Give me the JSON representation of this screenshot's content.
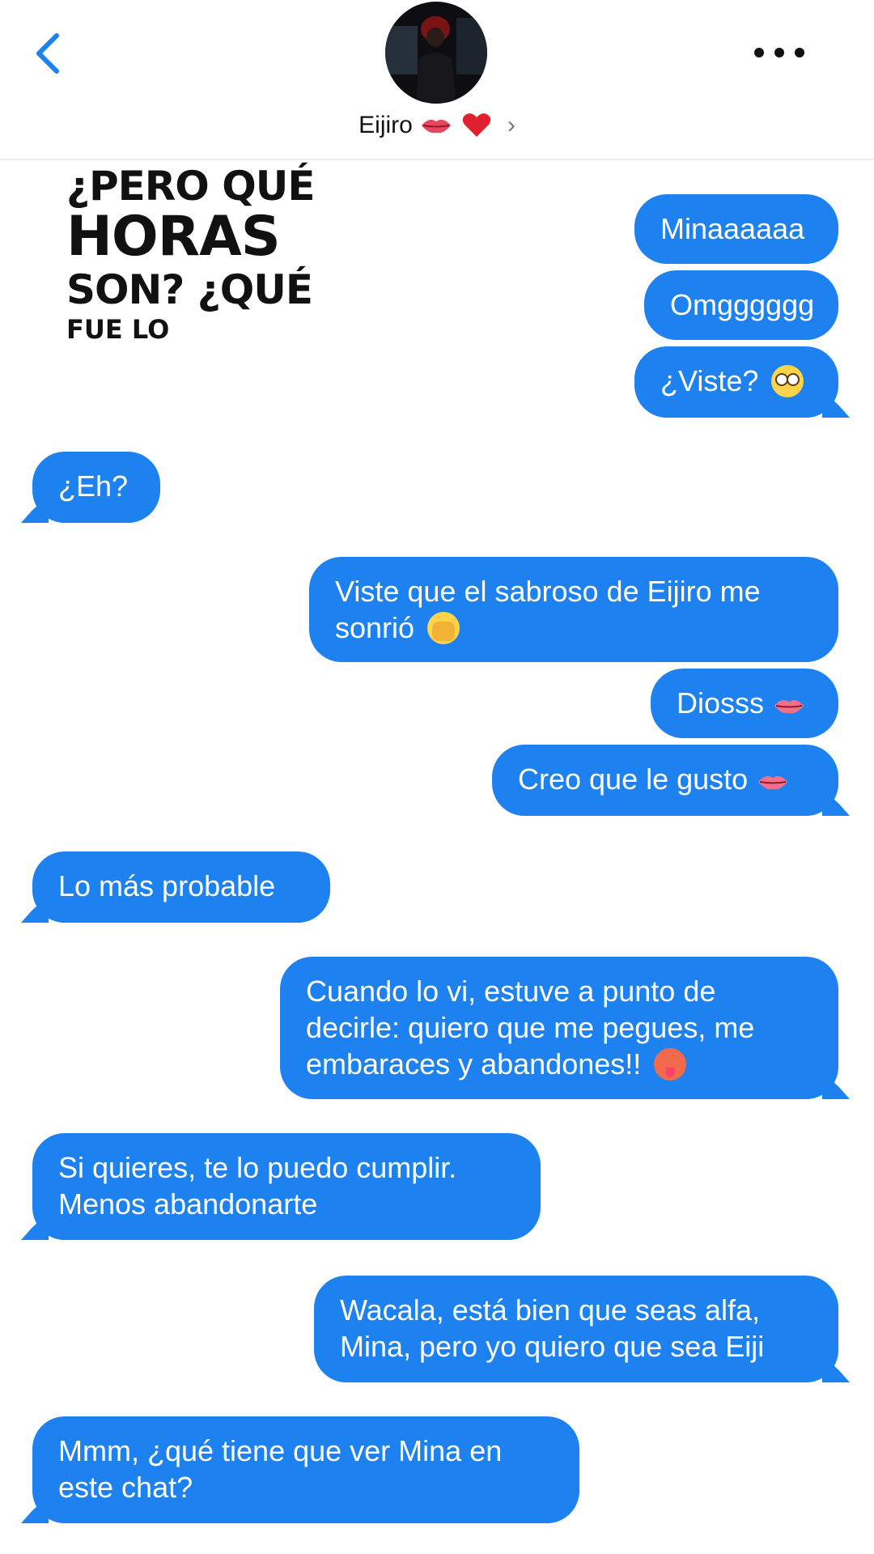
{
  "header": {
    "contact_name": "Eijiro",
    "back_icon": "chevron-left-icon",
    "more_icon": "more-horizontal-icon",
    "name_emojis": [
      "lips-emoji",
      "heart-emoji"
    ],
    "accent_color": "#1d82f0"
  },
  "meme": {
    "line1": "¿PERO QUÉ",
    "line2": "HORAS",
    "line3": "SON? ¿QUÉ",
    "line4": "FUE LO"
  },
  "messages": [
    {
      "side": "sent",
      "text": "Minaaaaaa"
    },
    {
      "side": "sent",
      "text": "Omgggggg"
    },
    {
      "side": "sent",
      "text": "¿Viste?",
      "emoji": "flushed-face-emoji"
    },
    {
      "side": "received",
      "text": "¿Eh?"
    },
    {
      "side": "sent",
      "text": "Viste que el sabroso de Eijiro me sonrió",
      "emoji": "face-with-hands-over-mouth-emoji"
    },
    {
      "side": "sent",
      "text": "Diosss",
      "emoji": "lips-emoji"
    },
    {
      "side": "sent",
      "text": "Creo que le gusto",
      "emoji": "lips-emoji"
    },
    {
      "side": "received",
      "text": "Lo más probable"
    },
    {
      "side": "sent",
      "text": "Cuando lo vi, estuve a punto de decirle: quiero que me pegues, me embaraces y abandones!!",
      "emoji": "hot-face-emoji"
    },
    {
      "side": "received",
      "text": "Si quieres, te lo puedo cumplir. Menos abandonarte"
    },
    {
      "side": "sent",
      "text": "Wacala, está bien que seas alfa, Mina, pero yo quiero que sea Eiji"
    },
    {
      "side": "received",
      "text": "Mmm, ¿qué tiene que ver Mina en este chat?"
    }
  ]
}
